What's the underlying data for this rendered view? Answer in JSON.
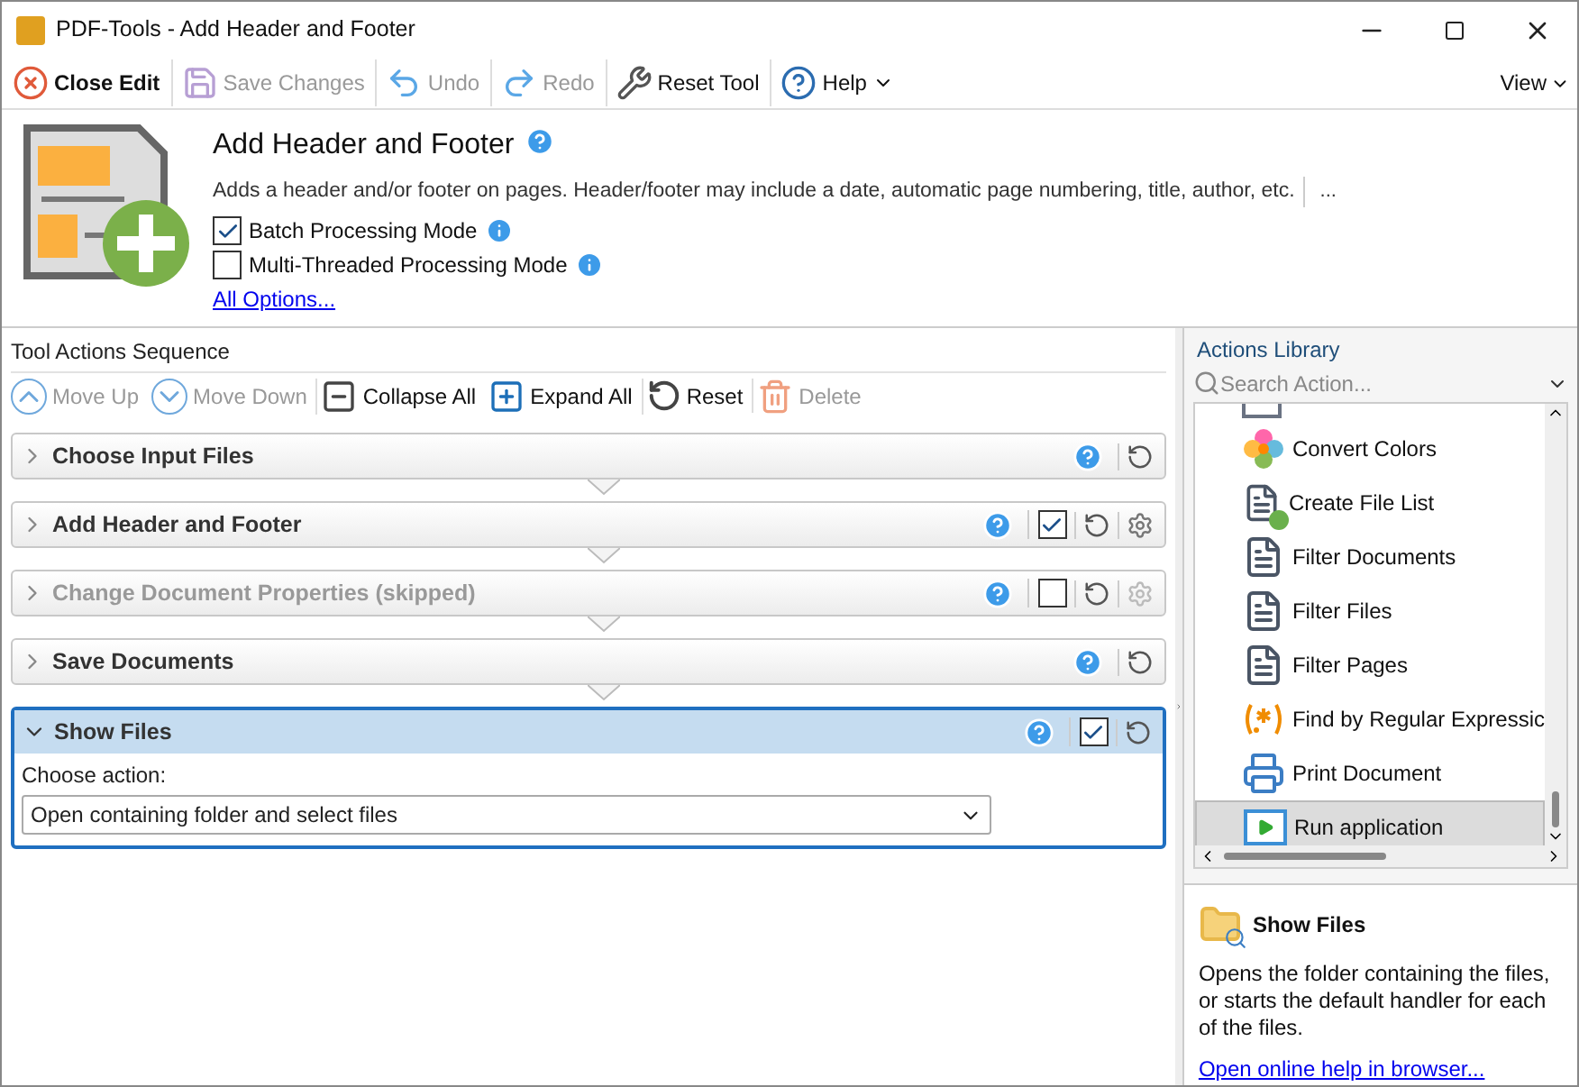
{
  "window": {
    "title": "PDF-Tools - Add Header and Footer"
  },
  "toolbar": {
    "items": [
      {
        "kind": "close",
        "label": "Close Edit",
        "disabled": false
      },
      {
        "kind": "save",
        "label": "Save Changes",
        "disabled": true
      },
      {
        "kind": "undo",
        "label": "Undo",
        "disabled": true
      },
      {
        "kind": "redo",
        "label": "Redo",
        "disabled": true
      },
      {
        "kind": "reset",
        "label": "Reset Tool",
        "disabled": false
      },
      {
        "kind": "help",
        "label": "Help",
        "disabled": false
      }
    ],
    "view": "View"
  },
  "tool": {
    "title": "Add Header and Footer",
    "description": "Adds a header and/or footer on pages. Header/footer may include a date, automatic page numbering, title, author, etc.",
    "more": "...",
    "options": [
      {
        "label": "Batch Processing Mode",
        "checked": true
      },
      {
        "label": "Multi-Threaded Processing Mode",
        "checked": false
      }
    ],
    "link": "All Options..."
  },
  "sequence": {
    "title": "Tool Actions Sequence",
    "toolbar": [
      {
        "kind": "up",
        "label": "Move Up",
        "disabled": true
      },
      {
        "kind": "down",
        "label": "Move Down",
        "disabled": true
      },
      {
        "kind": "collapse",
        "label": "Collapse All",
        "disabled": false
      },
      {
        "kind": "expand",
        "label": "Expand All",
        "disabled": false
      },
      {
        "kind": "reset",
        "label": "Reset",
        "disabled": false
      },
      {
        "kind": "delete",
        "label": "Delete",
        "disabled": true
      }
    ],
    "actions": [
      {
        "title": "Choose Input Files",
        "kind": "fixed",
        "expanded": false,
        "selected": false,
        "disabled": false
      },
      {
        "title": "Add Header and Footer",
        "kind": "configurable",
        "checked": true,
        "expanded": false,
        "selected": false,
        "disabled": false
      },
      {
        "title": "Change Document Properties (skipped)",
        "kind": "configurable",
        "checked": false,
        "expanded": false,
        "selected": false,
        "disabled": true
      },
      {
        "title": "Save Documents",
        "kind": "fixed",
        "expanded": false,
        "selected": false,
        "disabled": false
      },
      {
        "title": "Show Files",
        "kind": "optional",
        "checked": true,
        "expanded": true,
        "selected": true,
        "disabled": false,
        "field_label": "Choose action:",
        "field_value": "Open containing folder and select files"
      }
    ]
  },
  "library": {
    "title": "Actions Library",
    "search": {
      "placeholder": "Search Action..."
    },
    "items": [
      {
        "kind": "partial",
        "selected": false
      },
      {
        "kind": "colors",
        "label": "Convert Colors",
        "selected": false
      },
      {
        "kind": "list",
        "label": "Create File List",
        "selected": false
      },
      {
        "kind": "filter",
        "label": "Filter Documents",
        "selected": false
      },
      {
        "kind": "filter",
        "label": "Filter Files",
        "selected": false
      },
      {
        "kind": "filter",
        "label": "Filter Pages",
        "selected": false
      },
      {
        "kind": "regex",
        "label": "Find by Regular Expressic",
        "selected": false
      },
      {
        "kind": "print",
        "label": "Print Document",
        "selected": false
      },
      {
        "kind": "run",
        "label": "Run application",
        "selected": true
      }
    ]
  },
  "info": {
    "title": "Show Files",
    "description": "Opens the folder containing the files, or starts the default handler for each of the files.",
    "link": "Open online help in browser..."
  }
}
